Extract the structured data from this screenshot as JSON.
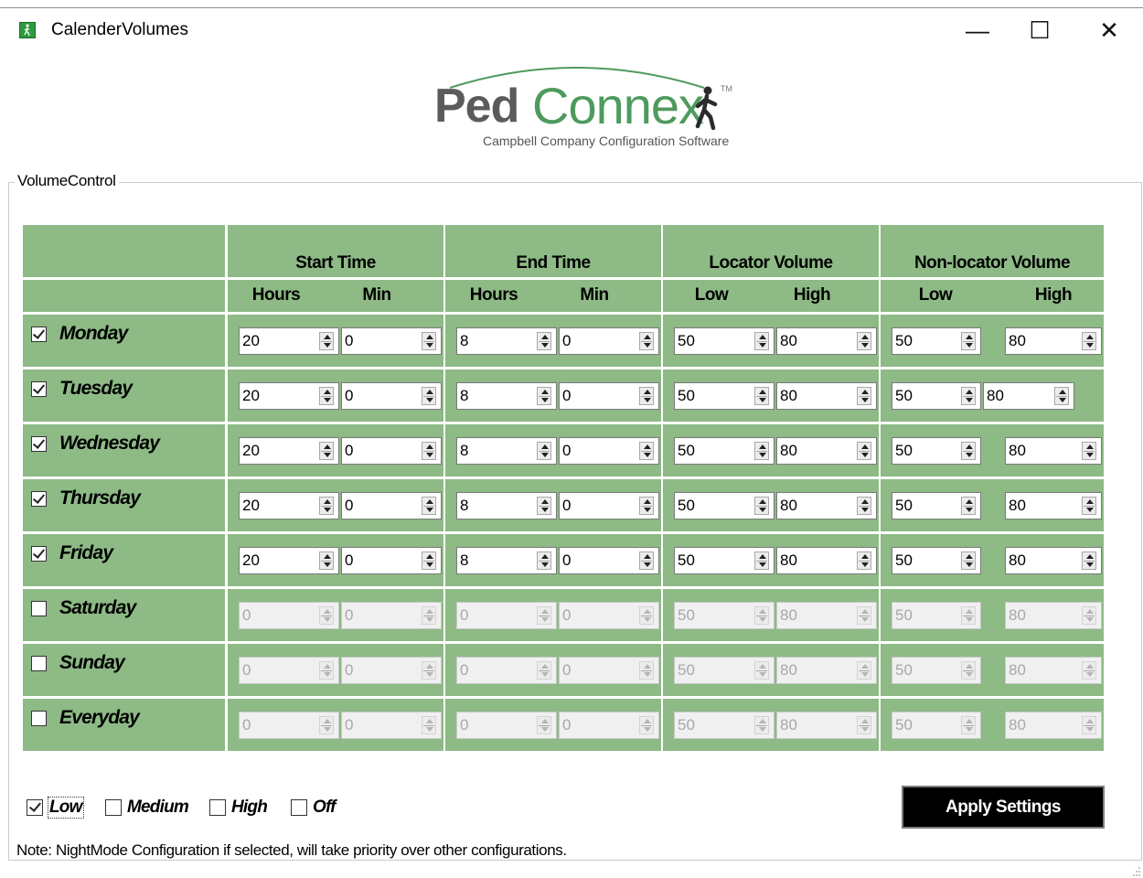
{
  "window": {
    "title": "CalenderVolumes",
    "minimize_glyph": "—",
    "maximize_glyph": "☐",
    "close_glyph": "✕",
    "icon": "walking-person-icon",
    "icon_color": "#2e9a3e"
  },
  "logo": {
    "ped": "Ped",
    "connex": "Connex",
    "tm": "TM",
    "subtitle": "Campbell Company Configuration Software"
  },
  "group": {
    "label": "VolumeControl"
  },
  "colors": {
    "grid_green": "#8dba85",
    "button_bg": "#000000"
  },
  "table": {
    "groups": [
      "Start Time",
      "End Time",
      "Locator Volume",
      "Non-locator Volume"
    ],
    "subheaders": [
      "Hours",
      "Min",
      "Hours",
      "Min",
      "Low",
      "High",
      "Low",
      "High"
    ],
    "rows": [
      {
        "day": "Monday",
        "checked": true,
        "values": [
          "20",
          "0",
          "8",
          "0",
          "50",
          "80",
          "50",
          "80"
        ]
      },
      {
        "day": "Tuesday",
        "checked": true,
        "values": [
          "20",
          "0",
          "8",
          "0",
          "50",
          "80",
          "50",
          "80"
        ]
      },
      {
        "day": "Wednesday",
        "checked": true,
        "values": [
          "20",
          "0",
          "8",
          "0",
          "50",
          "80",
          "50",
          "80"
        ]
      },
      {
        "day": "Thursday",
        "checked": true,
        "values": [
          "20",
          "0",
          "8",
          "0",
          "50",
          "80",
          "50",
          "80"
        ]
      },
      {
        "day": "Friday",
        "checked": true,
        "values": [
          "20",
          "0",
          "8",
          "0",
          "50",
          "80",
          "50",
          "80"
        ]
      },
      {
        "day": "Saturday",
        "checked": false,
        "values": [
          "0",
          "0",
          "0",
          "0",
          "50",
          "80",
          "50",
          "80"
        ]
      },
      {
        "day": "Sunday",
        "checked": false,
        "values": [
          "0",
          "0",
          "0",
          "0",
          "50",
          "80",
          "50",
          "80"
        ]
      },
      {
        "day": "Everyday",
        "checked": false,
        "values": [
          "0",
          "0",
          "0",
          "0",
          "50",
          "80",
          "50",
          "80"
        ]
      }
    ]
  },
  "nightmode": {
    "options": [
      {
        "label": "Low",
        "checked": true
      },
      {
        "label": "Medium",
        "checked": false
      },
      {
        "label": "High",
        "checked": false
      },
      {
        "label": "Off",
        "checked": false
      }
    ]
  },
  "apply_button": {
    "label": "Apply Settings"
  },
  "note": "Note: NightMode Configuration if selected, will take priority over other configurations."
}
